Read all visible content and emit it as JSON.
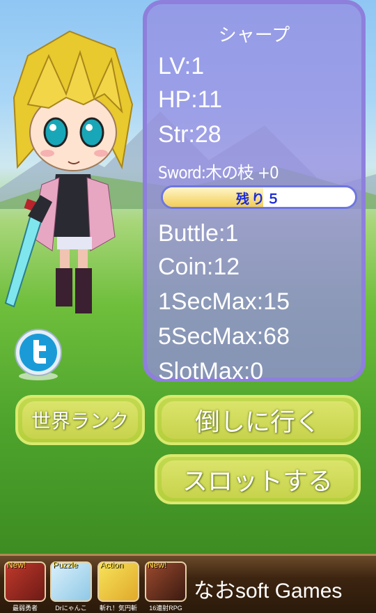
{
  "stats": {
    "name": "シャープ",
    "lv": "LV:1",
    "hp": "HP:11",
    "str": "Str:28",
    "sword": "Sword:木の枝 +0",
    "remaining_label": "残り５",
    "remaining_fraction": 0.52,
    "buttle": "Buttle:1",
    "coin": "Coin:12",
    "sec1": "1SecMax:15",
    "sec5": "5SecMax:68",
    "slot": "SlotMax:0"
  },
  "buttons": {
    "rank": "世界ランク",
    "attack": "倒しに行く",
    "slot": "スロットする"
  },
  "ads": {
    "brand": "なおsoft Games",
    "apps": [
      {
        "badge": "New!",
        "name": "最弱勇者",
        "color": "#c0392b"
      },
      {
        "badge": "Puzzle",
        "name": "Drにゃんこ",
        "color": "#bfe3f5"
      },
      {
        "badge": "Action",
        "name": "斬れ！気円斬",
        "color": "#f2d23c"
      },
      {
        "badge": "New!",
        "name": "16連射RPG",
        "color": "#7b3b2a"
      }
    ]
  },
  "colors": {
    "panel": "#8e7fdc",
    "button": "#c2d94f",
    "bar_text": "#1b2bd8"
  }
}
